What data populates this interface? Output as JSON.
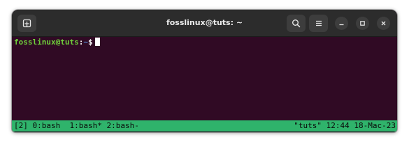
{
  "window": {
    "title": "fosslinux@tuts: ~"
  },
  "titlebar": {
    "icons": {
      "new_tab": "new-tab-icon",
      "search": "search-icon",
      "menu": "hamburger-menu-icon",
      "minimize": "minimize-icon",
      "maximize": "maximize-icon",
      "close": "close-icon"
    }
  },
  "terminal": {
    "prompt_user_host": "fosslinux@tuts",
    "prompt_separator": ":",
    "prompt_path": "~",
    "prompt_symbol": "$",
    "colors": {
      "background": "#300a24",
      "user_host": "#6fcf3a",
      "path": "#5a8fd8"
    }
  },
  "tmux_status": {
    "session": "[2]",
    "windows": [
      {
        "label": "0:bash"
      },
      {
        "label": "1:bash*"
      },
      {
        "label": "2:bash-"
      }
    ],
    "right_text": "\"tuts\" 12:44 18-Mac-23",
    "color": "#2fb36b"
  }
}
